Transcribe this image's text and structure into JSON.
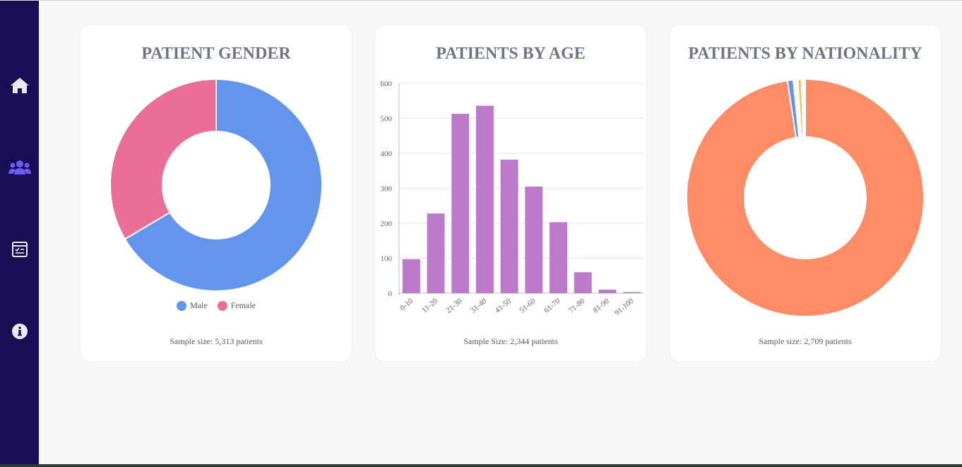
{
  "sidebar": {
    "items": [
      {
        "icon": "home-icon",
        "name": "Home"
      },
      {
        "icon": "users-icon",
        "name": "Patients",
        "active": true
      },
      {
        "icon": "report-icon",
        "name": "Reports"
      },
      {
        "icon": "info-icon",
        "name": "Info"
      }
    ],
    "colors": {
      "background": "#1b0d55",
      "icon": "#e9e9f2",
      "active_icon": "#6b5cf6"
    }
  },
  "cards": [
    {
      "title": "PATIENT GENDER",
      "sample_text": "Sample size: 5,313 patients",
      "legend": [
        {
          "label": "Male",
          "color": "#6495ed"
        },
        {
          "label": "Female",
          "color": "#eb6e99"
        }
      ]
    },
    {
      "title": "PATIENTS BY AGE",
      "sample_text": "Sample Size: 2,344 patients"
    },
    {
      "title": "PATIENTS BY NATIONALITY",
      "sample_text": "Sample size: 2,709 patients"
    }
  ],
  "chart_data": [
    {
      "type": "pie",
      "variant": "doughnut",
      "labels": [
        "Male",
        "Female"
      ],
      "values": [
        66.5,
        33.5
      ],
      "colors": [
        "#6495ed",
        "#eb6e99"
      ],
      "legend_position": "bottom"
    },
    {
      "type": "bar",
      "categories": [
        "0-10",
        "11-20",
        "21-30",
        "31-40",
        "41-50",
        "51-60",
        "61-70",
        "71-80",
        "81-90",
        "91-100"
      ],
      "values": [
        97,
        228,
        513,
        536,
        382,
        305,
        203,
        60,
        10,
        3
      ],
      "ylim": [
        0,
        600
      ],
      "yticks": [
        0,
        100,
        200,
        300,
        400,
        500,
        600
      ],
      "color": "#bc7bca",
      "grid": true
    },
    {
      "type": "pie",
      "variant": "doughnut",
      "values": [
        97.6,
        0.8,
        0.6,
        0.5,
        0.5
      ],
      "colors": [
        "#ff8c66",
        "#6d8fe8",
        "#ffffff",
        "#f2c14e",
        "#ffffff"
      ]
    }
  ]
}
